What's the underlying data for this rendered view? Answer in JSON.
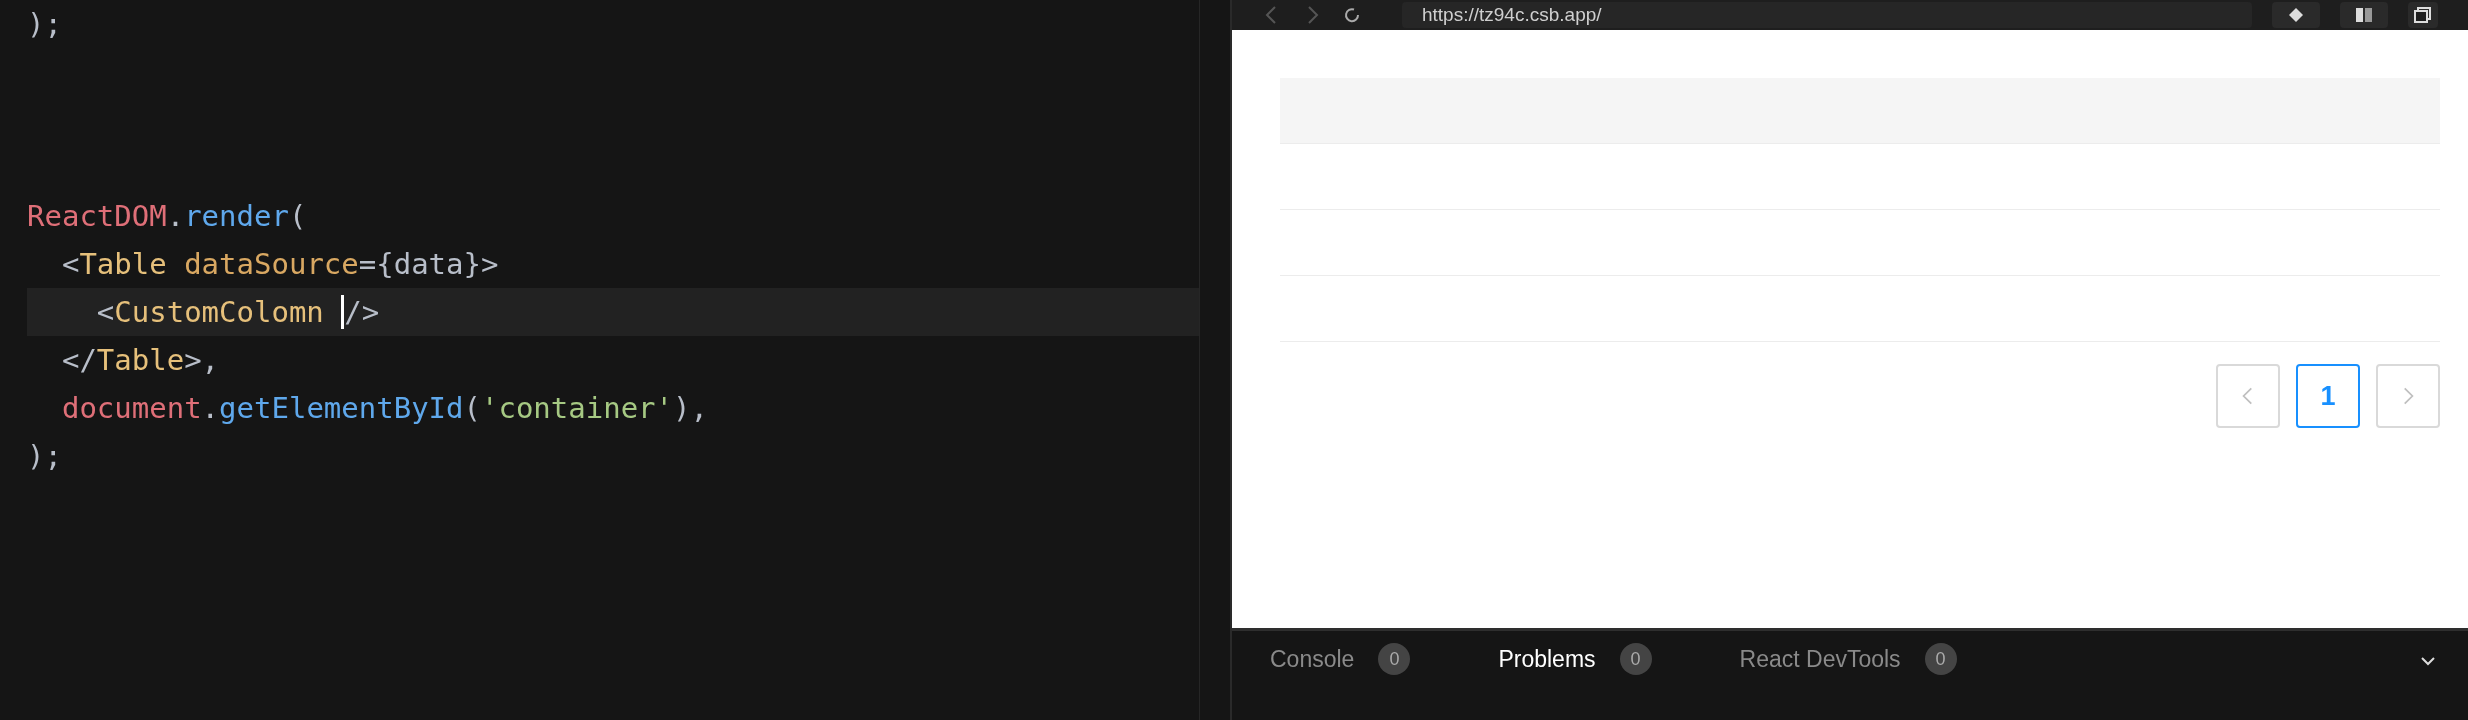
{
  "editor": {
    "lines": [
      {
        "current": false,
        "tokens": [
          {
            "kind": "punct",
            "text": ");"
          }
        ]
      },
      {
        "current": false
      },
      {
        "current": false
      },
      {
        "current": false
      },
      {
        "current": false,
        "tokens": [
          {
            "kind": "object",
            "text": "ReactDOM"
          },
          {
            "kind": "punct",
            "text": "."
          },
          {
            "kind": "method",
            "text": "render"
          },
          {
            "kind": "punct",
            "text": "("
          }
        ]
      },
      {
        "current": false,
        "tokens": [
          {
            "kind": "punct",
            "text": "  <"
          },
          {
            "kind": "component",
            "text": "Table"
          },
          {
            "kind": "attribute",
            "text": " dataSource"
          },
          {
            "kind": "punct",
            "text": "={data}>"
          }
        ]
      },
      {
        "current": true,
        "tokens": [
          {
            "kind": "punct",
            "text": "    <"
          },
          {
            "kind": "component",
            "text": "CustomColomn "
          },
          {
            "kind": "cursor"
          },
          {
            "kind": "punct",
            "text": "/>"
          }
        ]
      },
      {
        "current": false,
        "tokens": [
          {
            "kind": "punct",
            "text": "  </"
          },
          {
            "kind": "component",
            "text": "Table"
          },
          {
            "kind": "punct",
            "text": ">,"
          }
        ]
      },
      {
        "current": false,
        "tokens": [
          {
            "kind": "object",
            "text": "  document"
          },
          {
            "kind": "punct",
            "text": "."
          },
          {
            "kind": "method",
            "text": "getElementById"
          },
          {
            "kind": "punct",
            "text": "("
          },
          {
            "kind": "string",
            "text": "'container'"
          },
          {
            "kind": "punct",
            "text": "),"
          }
        ]
      },
      {
        "current": false,
        "tokens": [
          {
            "kind": "punct",
            "text": ");"
          }
        ]
      }
    ]
  },
  "browser": {
    "url": "https://tz94c.csb.app/",
    "table": {
      "rows": [
        {
          "kind": "header"
        },
        {
          "kind": "empty"
        },
        {
          "kind": "empty"
        },
        {
          "kind": "empty"
        }
      ]
    },
    "pagination": [
      {
        "kind": "prev",
        "disabled": true
      },
      {
        "kind": "page",
        "label": "1",
        "selected": true
      },
      {
        "kind": "next",
        "disabled": true
      }
    ]
  },
  "panel": {
    "tabs": [
      {
        "label": "Console",
        "count": "0",
        "selected": false
      },
      {
        "label": "Problems",
        "count": "0",
        "selected": true
      },
      {
        "label": "React DevTools",
        "count": "0",
        "selected": false
      }
    ]
  }
}
